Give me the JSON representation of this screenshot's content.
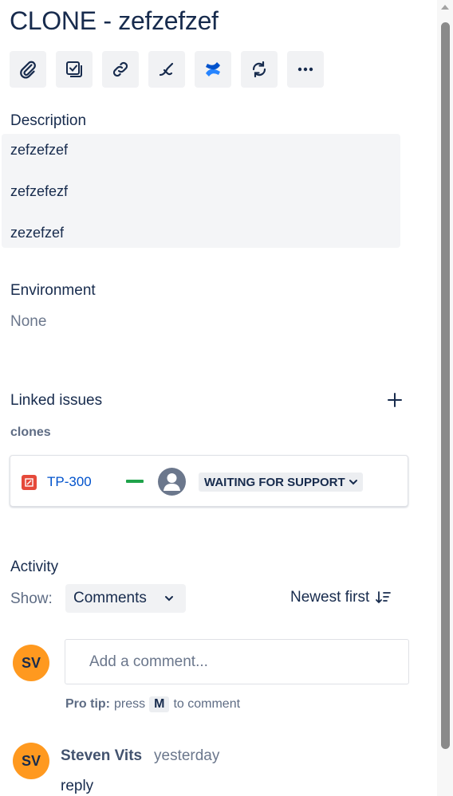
{
  "issue": {
    "title": "CLONE - zefzefzef"
  },
  "toolbar": {
    "buttons": [
      {
        "icon": "attachment-icon"
      },
      {
        "icon": "subtask-checkbox-icon"
      },
      {
        "icon": "link-icon"
      },
      {
        "icon": "bitbucket-branch-icon"
      },
      {
        "icon": "confluence-icon"
      },
      {
        "icon": "sync-icon"
      },
      {
        "icon": "more-icon"
      }
    ]
  },
  "description": {
    "label": "Description",
    "lines": [
      "zefzefzef",
      "zefzefezf",
      "zezefzef"
    ]
  },
  "environment": {
    "label": "Environment",
    "value": "None"
  },
  "linked_issues": {
    "label": "Linked issues",
    "add_label": "+",
    "relation": "clones",
    "items": [
      {
        "key": "TP-300",
        "status": "WAITING FOR SUPPORT",
        "priority_color": "#1fa34a",
        "type_color": "#e5493a"
      }
    ]
  },
  "activity": {
    "label": "Activity",
    "show_label": "Show:",
    "filter_value": "Comments",
    "sort_label": "Newest first",
    "input_placeholder": "Add a comment...",
    "pro_tip_label": "Pro tip:",
    "pro_tip_press": "press",
    "pro_tip_key": "M",
    "pro_tip_suffix": "to comment",
    "current_user_initials": "SV",
    "comments": [
      {
        "initials": "SV",
        "author": "Steven Vits",
        "time": "yesterday",
        "body": "reply"
      }
    ]
  },
  "colors": {
    "accent": "#0052cc",
    "avatar": "#ff991f",
    "text": "#172b4d"
  }
}
